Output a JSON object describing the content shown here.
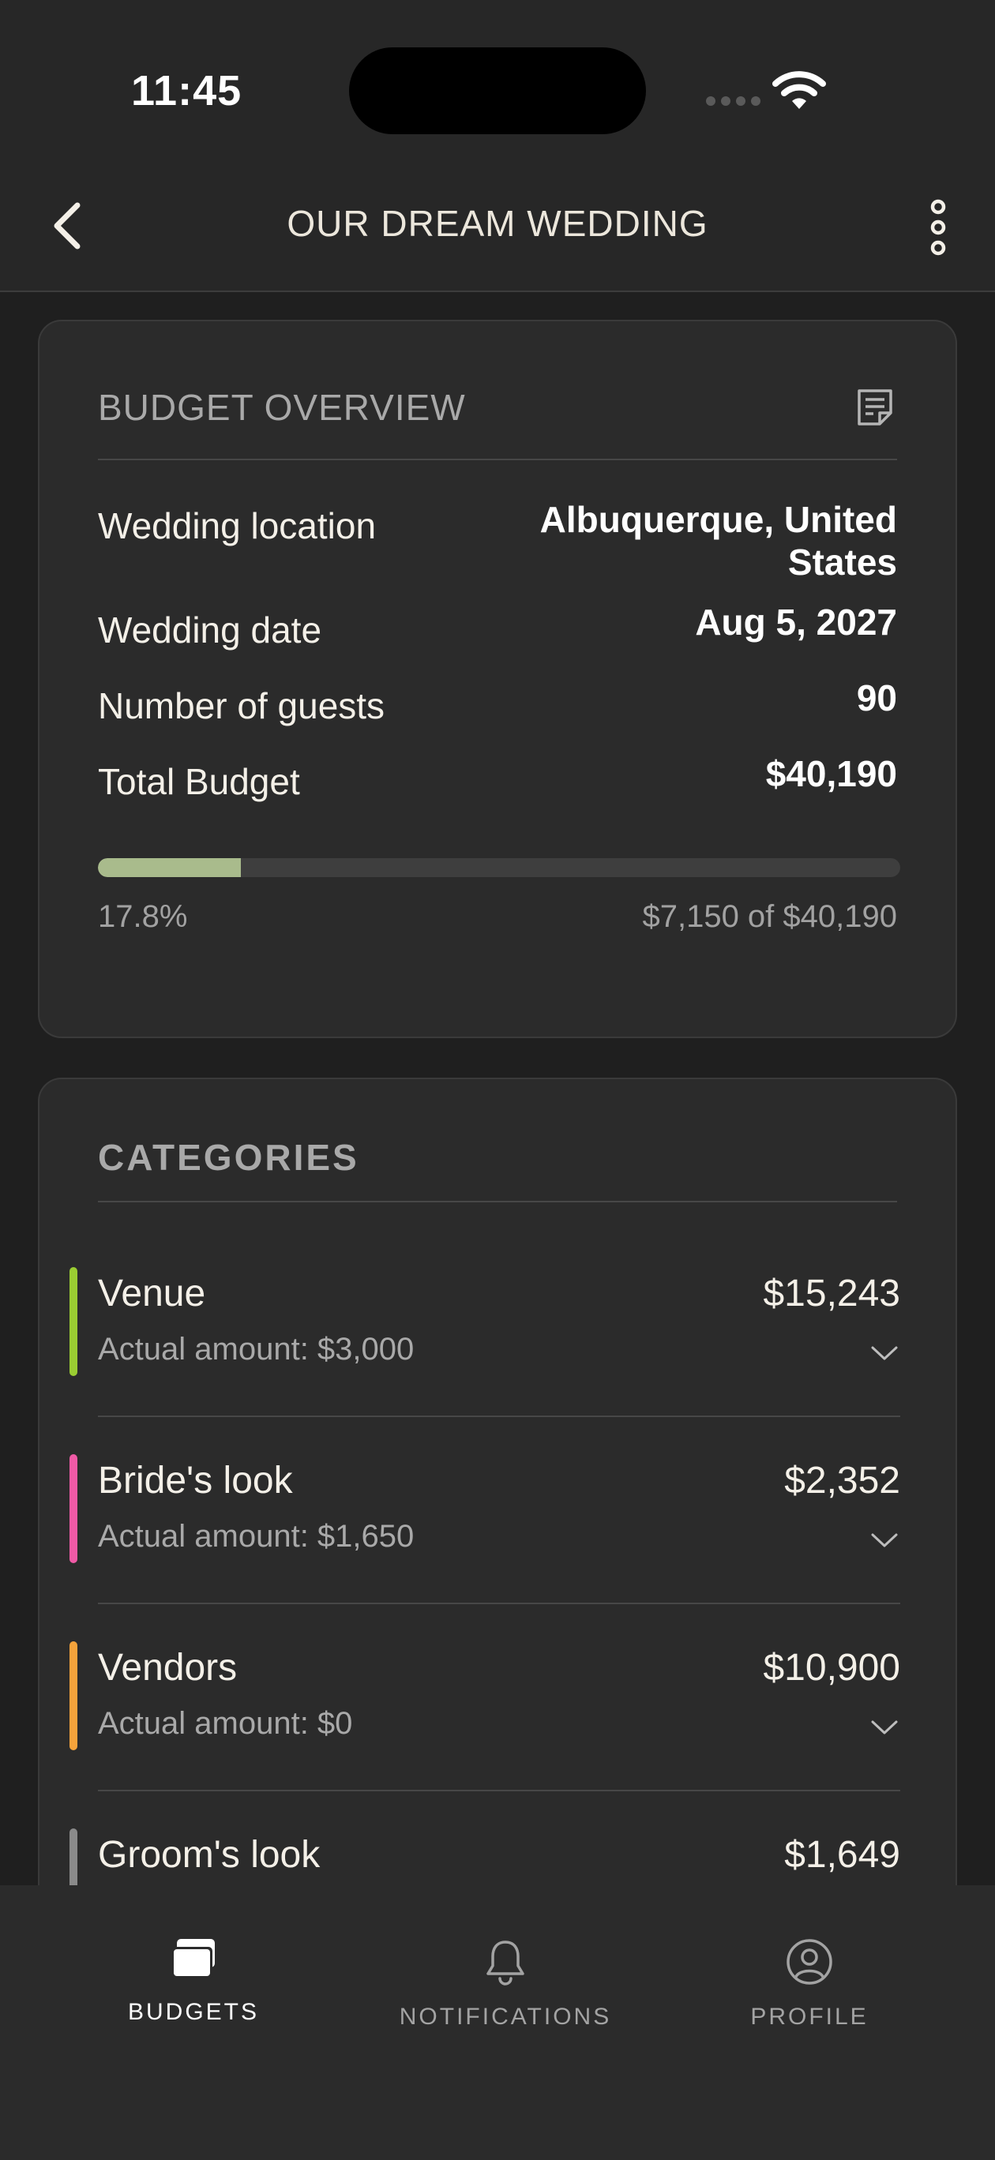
{
  "status_bar": {
    "time": "11:45"
  },
  "header": {
    "title": "OUR DREAM WEDDING"
  },
  "budget_overview": {
    "title": "BUDGET OVERVIEW",
    "rows": [
      {
        "label": "Wedding location",
        "value_line1": "Albuquerque, United",
        "value_line2": "States"
      },
      {
        "label": "Wedding date",
        "value": "Aug 5, 2027"
      },
      {
        "label": "Number of guests",
        "value": "90"
      },
      {
        "label": "Total Budget",
        "value": "$40,190"
      }
    ],
    "progress": {
      "fraction": 0.178,
      "percent_label": "17.8%",
      "amount_label": "$7,150 of $40,190"
    }
  },
  "categories": {
    "title": "CATEGORIES",
    "items": [
      {
        "name": "Venue",
        "amount": "$15,243",
        "actual": "Actual amount: $3,000",
        "color": "#9acd32"
      },
      {
        "name": "Bride's look",
        "amount": "$2,352",
        "actual": "Actual amount: $1,650",
        "color": "#f05aa6"
      },
      {
        "name": "Vendors",
        "amount": "$10,900",
        "actual": "Actual amount: $0",
        "color": "#f5a33b"
      },
      {
        "name": "Groom's look",
        "amount": "$1,649",
        "actual": "",
        "color": "#8a8a8a"
      }
    ]
  },
  "tabs": [
    {
      "label": "BUDGETS",
      "icon": "wallet-cards-icon",
      "active": true
    },
    {
      "label": "NOTIFICATIONS",
      "icon": "bell-icon",
      "active": false
    },
    {
      "label": "PROFILE",
      "icon": "user-circle-icon",
      "active": false
    }
  ],
  "colors": {
    "active_tab": "#ffffff",
    "inactive_tab": "#a3a3a3",
    "progress_fill": "#a9bb8c"
  }
}
